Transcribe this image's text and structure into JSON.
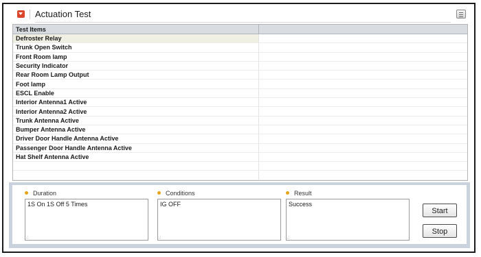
{
  "header": {
    "title": "Actuation Test"
  },
  "table": {
    "headers": [
      "Test Items",
      ""
    ],
    "rows": [
      {
        "item": "Defroster Relay",
        "value": ""
      },
      {
        "item": "Trunk Open Switch",
        "value": ""
      },
      {
        "item": "Front Room lamp",
        "value": ""
      },
      {
        "item": "Security Indicator",
        "value": ""
      },
      {
        "item": "Rear Room Lamp Output",
        "value": ""
      },
      {
        "item": "Foot lamp",
        "value": ""
      },
      {
        "item": "ESCL Enable",
        "value": ""
      },
      {
        "item": "Interior Antenna1 Active",
        "value": ""
      },
      {
        "item": "Interior Antenna2 Active",
        "value": ""
      },
      {
        "item": "Trunk Antenna Active",
        "value": ""
      },
      {
        "item": "Bumper Antenna Active",
        "value": ""
      },
      {
        "item": "Driver Door Handle Antenna Active",
        "value": ""
      },
      {
        "item": "Passenger Door Handle Antenna Active",
        "value": ""
      },
      {
        "item": "Hat Shelf Antenna Active",
        "value": ""
      },
      {
        "item": "",
        "value": ""
      },
      {
        "item": "",
        "value": ""
      }
    ],
    "selected_index": 0
  },
  "panel": {
    "duration_label": "Duration",
    "duration_value": "1S On 1S Off 5 Times",
    "conditions_label": "Conditions",
    "conditions_value": "IG OFF",
    "result_label": "Result",
    "result_value": "Success",
    "start_label": "Start",
    "stop_label": "Stop"
  },
  "colors": {
    "collapse_button": "#d9462c",
    "header_row": "#d9dde2",
    "selected_row": "#efefe3",
    "panel_border": "#c9d2dd",
    "bullet": "#e8a31c"
  },
  "icons": {
    "collapse": "chevron-down-icon",
    "menu": "list-menu-icon"
  }
}
